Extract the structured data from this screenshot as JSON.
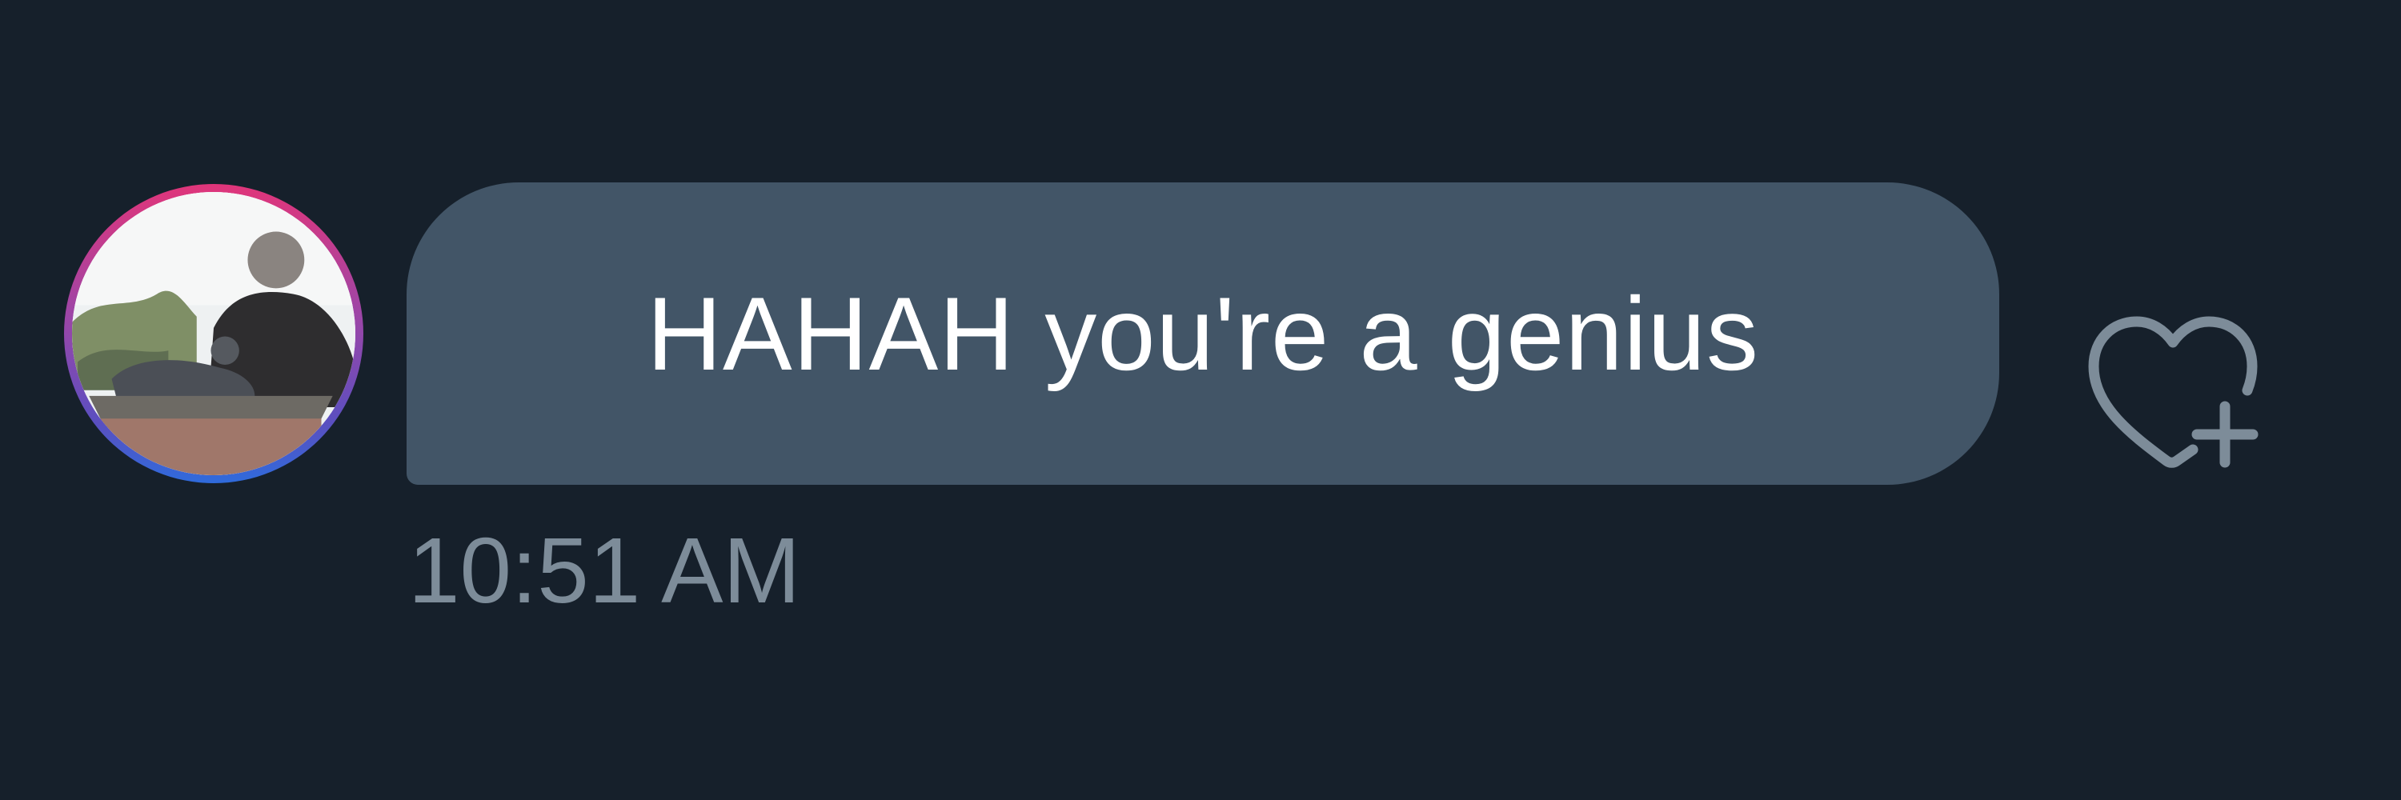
{
  "message": {
    "text": "HAHAH you're a genius",
    "timestamp": "10:51 AM",
    "reaction_icon": "heart-plus-icon"
  },
  "avatar": {
    "ring_colors": [
      "#e0357a",
      "#9b46a8",
      "#2f6bdc"
    ]
  },
  "theme": {
    "background": "#16202b",
    "bubble": "#425567",
    "text": "#ffffff",
    "muted": "#7d8c99"
  }
}
